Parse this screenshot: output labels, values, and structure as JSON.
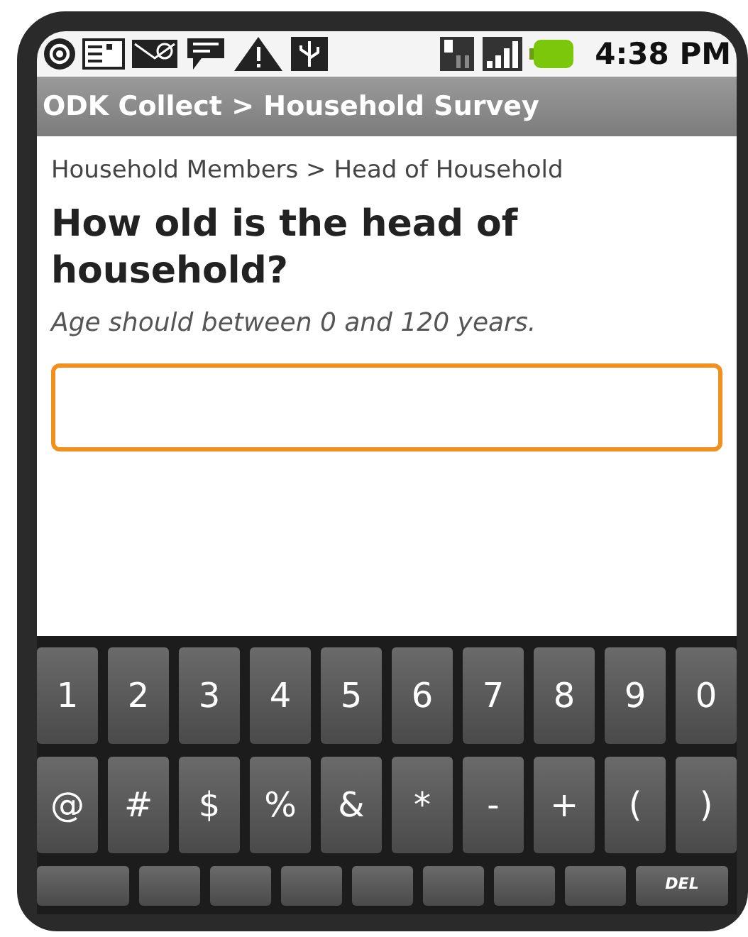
{
  "status_bar": {
    "time": "4:38 PM"
  },
  "title_bar": {
    "title": "ODK Collect > Household Survey"
  },
  "form": {
    "breadcrumb": "Household Members > Head of Household",
    "question": "How old is the head of household?",
    "hint": "Age should between 0 and 120 years.",
    "answer": {
      "focused": true
    }
  },
  "keyboard": {
    "rows": [
      [
        {
          "kind": "key",
          "label": "1"
        },
        {
          "kind": "key",
          "label": "2"
        },
        {
          "kind": "key",
          "label": "3"
        },
        {
          "kind": "key",
          "label": "4"
        },
        {
          "kind": "key",
          "label": "5"
        },
        {
          "kind": "key",
          "label": "6"
        },
        {
          "kind": "key",
          "label": "7"
        },
        {
          "kind": "key",
          "label": "8"
        },
        {
          "kind": "key",
          "label": "9"
        },
        {
          "kind": "key",
          "label": "0"
        }
      ],
      [
        {
          "kind": "key",
          "label": "@"
        },
        {
          "kind": "key",
          "label": "#"
        },
        {
          "kind": "key",
          "label": "$"
        },
        {
          "kind": "key",
          "label": "%"
        },
        {
          "kind": "key",
          "label": "&"
        },
        {
          "kind": "key",
          "label": "*"
        },
        {
          "kind": "key",
          "label": "-"
        },
        {
          "kind": "key",
          "label": "+"
        },
        {
          "kind": "key",
          "label": "("
        },
        {
          "kind": "key",
          "label": ")"
        }
      ],
      [
        {
          "kind": "wide"
        },
        {
          "kind": "blank"
        },
        {
          "kind": "blank"
        },
        {
          "kind": "blank"
        },
        {
          "kind": "blank"
        },
        {
          "kind": "blank"
        },
        {
          "kind": "blank"
        },
        {
          "kind": "blank"
        },
        {
          "kind": "del",
          "label": "DEL"
        }
      ]
    ]
  }
}
